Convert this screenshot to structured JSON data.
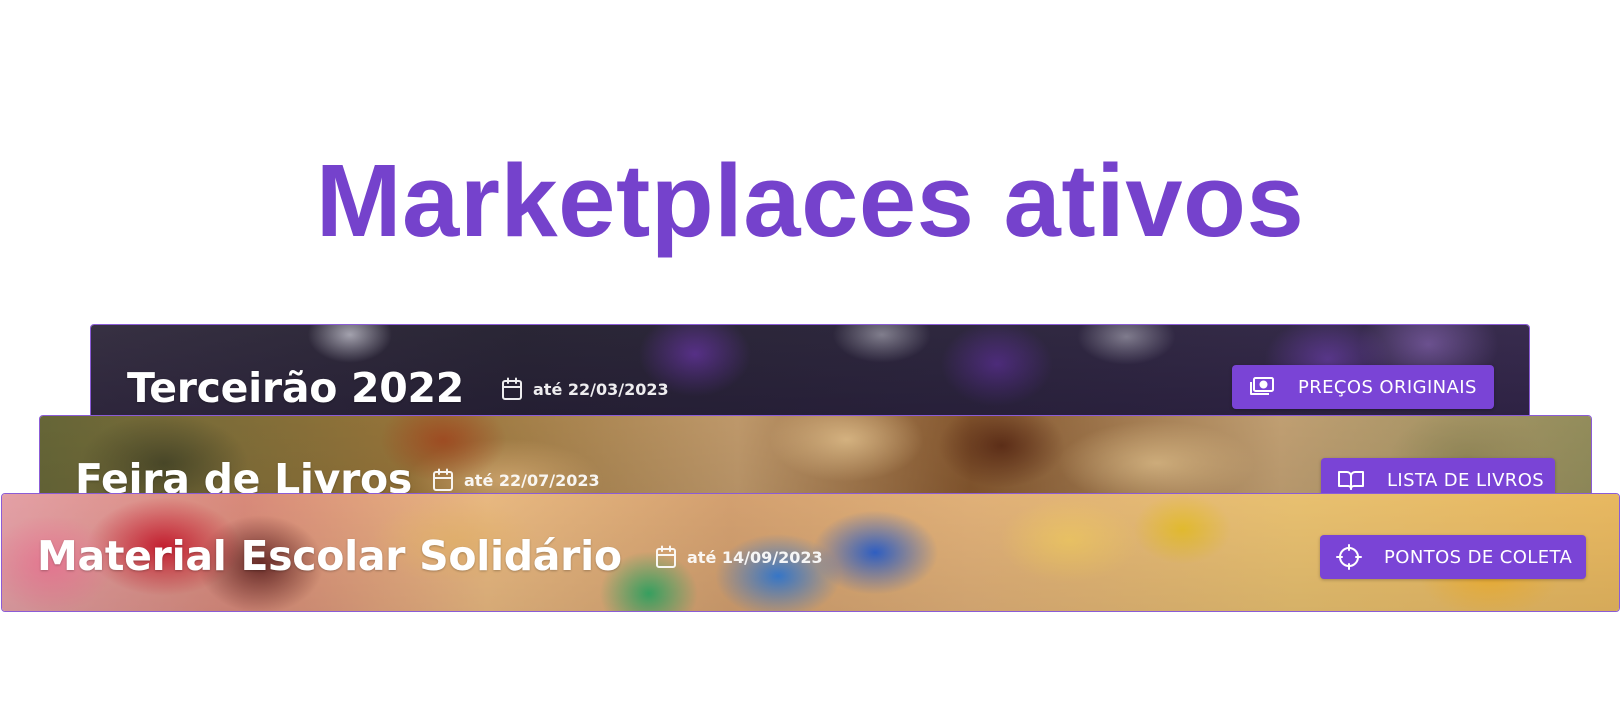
{
  "page": {
    "title": "Marketplaces ativos"
  },
  "colors": {
    "accent": "#7542cc",
    "button": "#7a44d6",
    "card_border": "#8b5cd6"
  },
  "marketplaces": [
    {
      "name": "Terceirão 2022",
      "date": "até 22/03/2023",
      "date_icon": "calendar-icon",
      "button": {
        "label": "PREÇOS ORIGINAIS",
        "icon": "money-icon"
      }
    },
    {
      "name": "Feira de Livros",
      "date": "até 22/07/2023",
      "date_icon": "calendar-icon",
      "button": {
        "label": "LISTA DE LIVROS",
        "icon": "book-open-icon"
      }
    },
    {
      "name": "Material Escolar Solidário",
      "date": "até 14/09/2023",
      "date_icon": "calendar-icon",
      "button": {
        "label": "PONTOS DE COLETA",
        "icon": "crosshair-icon"
      }
    }
  ]
}
